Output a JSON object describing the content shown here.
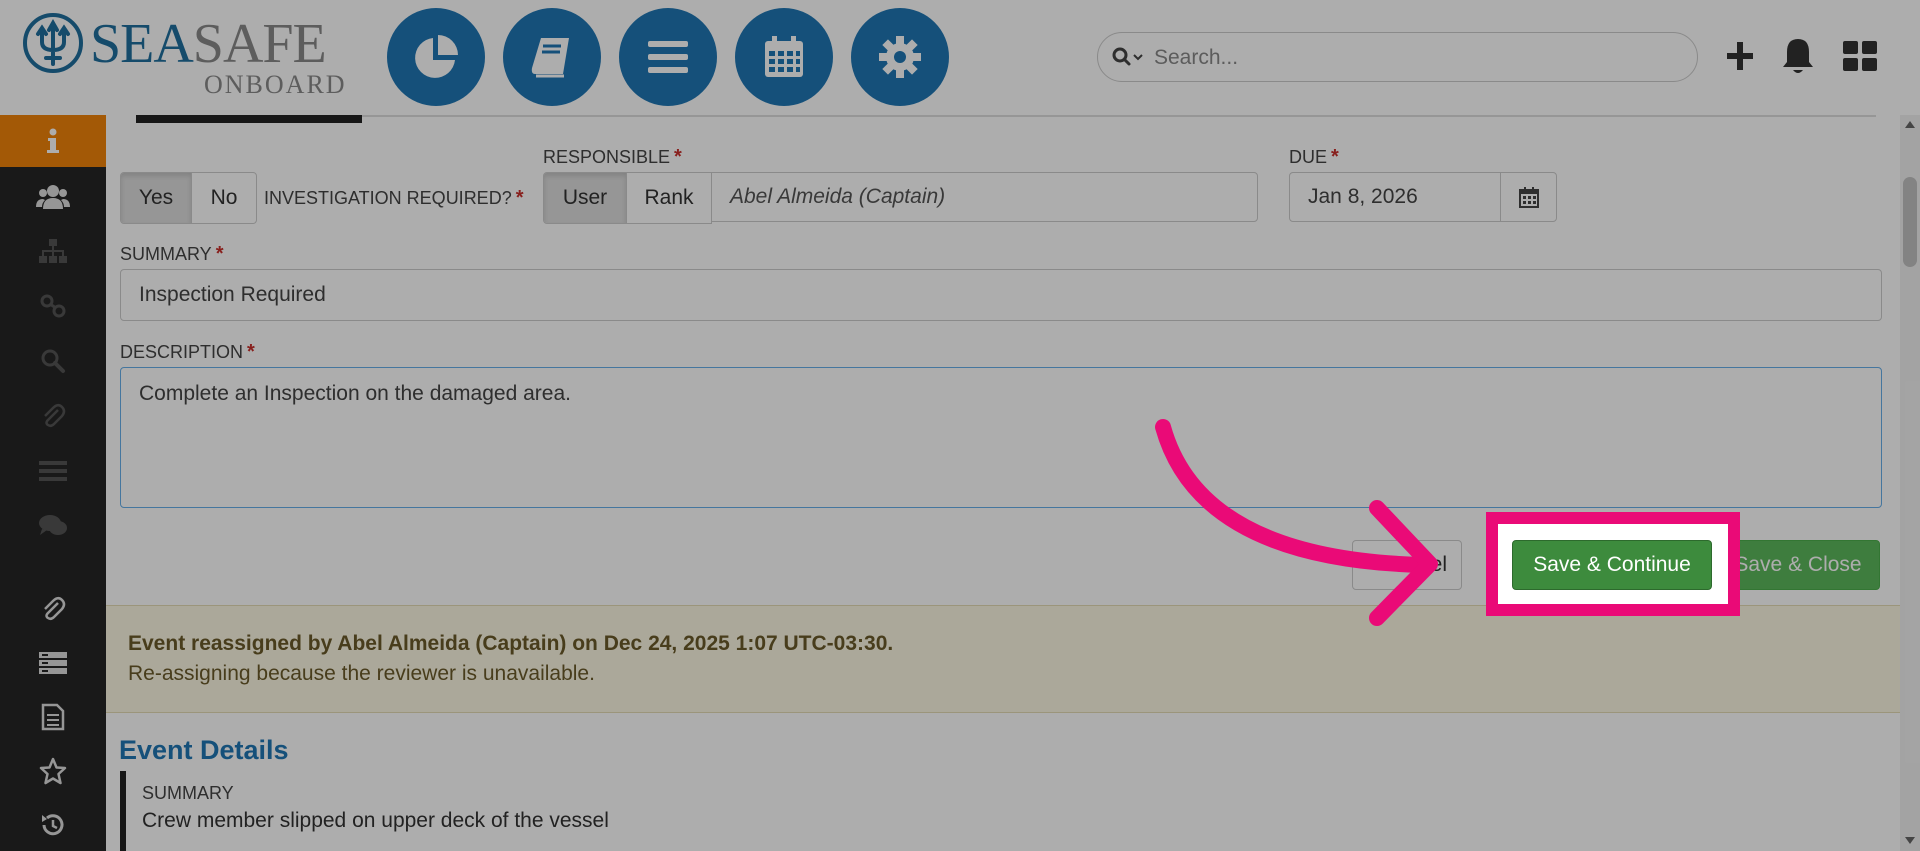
{
  "app": {
    "logo_text_primary": "SEA",
    "logo_text_secondary": "SAFE",
    "logo_subtext": "ONBOARD"
  },
  "topnav": {
    "buttons": [
      {
        "name": "dashboard-button",
        "icon": "pie-chart-icon"
      },
      {
        "name": "logbook-button",
        "icon": "book-icon"
      },
      {
        "name": "menu-button",
        "icon": "list-icon"
      },
      {
        "name": "calendar-button",
        "icon": "calendar-icon"
      },
      {
        "name": "settings-button",
        "icon": "gear-icon"
      }
    ],
    "search_placeholder": "Search...",
    "actions": [
      "plus-icon",
      "bell-icon",
      "grid-icon"
    ]
  },
  "sidebar": {
    "items": [
      {
        "icon": "info-icon",
        "active": true
      },
      {
        "icon": "users-icon"
      },
      {
        "icon": "sitemap-icon"
      },
      {
        "icon": "link-icon"
      },
      {
        "icon": "search-icon"
      },
      {
        "icon": "paperclip-icon"
      },
      {
        "icon": "list-lines-icon"
      },
      {
        "icon": "chat-icon"
      },
      {
        "icon": "paperclip-icon"
      },
      {
        "icon": "stack-icon"
      },
      {
        "icon": "document-icon"
      },
      {
        "icon": "star-icon"
      },
      {
        "icon": "history-icon"
      }
    ]
  },
  "form": {
    "investigation": {
      "yes_label": "Yes",
      "no_label": "No",
      "label": "INVESTIGATION REQUIRED?",
      "required_mark": "*"
    },
    "responsible": {
      "label": "RESPONSIBLE",
      "required_mark": "*",
      "user_label": "User",
      "rank_label": "Rank",
      "value": "Abel Almeida (Captain)"
    },
    "due": {
      "label": "DUE",
      "required_mark": "*",
      "value": "Jan 8, 2026"
    },
    "summary": {
      "label": "SUMMARY",
      "required_mark": "*",
      "value": "Inspection Required"
    },
    "description": {
      "label": "DESCRIPTION",
      "required_mark": "*",
      "value": "Complete an Inspection on the damaged area."
    },
    "buttons": {
      "cancel": "Cancel",
      "save_continue": "Save & Continue",
      "save_close": "Save & Close"
    }
  },
  "notice": {
    "line1": "Event reassigned by Abel Almeida (Captain) on Dec 24, 2025 1:07 UTC-03:30.",
    "line2": "Re-assigning because the reviewer is unavailable."
  },
  "event_details": {
    "title": "Event Details",
    "summary_label": "SUMMARY",
    "summary_value": "Crew member slipped on upper deck of the vessel"
  },
  "colors": {
    "primary": "#1f77b4",
    "sidebar_bg": "#262626",
    "sidebar_active": "#f0830a",
    "save_green": "#3d8b3d",
    "highlight": "#ea0a77",
    "required": "#c9302c",
    "notice_bg": "#fcf8e3"
  }
}
